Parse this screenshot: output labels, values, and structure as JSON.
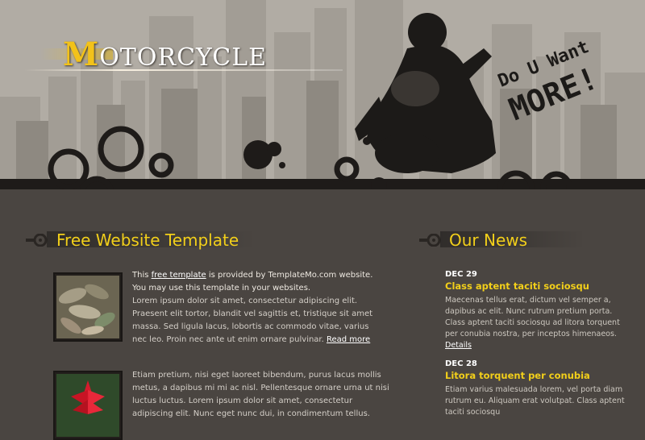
{
  "header": {
    "logo_cap": "M",
    "logo_rest": "OTORCYCLE",
    "slogan_line1": "Do U Want",
    "slogan_line2": "MORE!"
  },
  "main": {
    "heading": "Free Website Template",
    "intro_pre": "This ",
    "intro_link": "free template",
    "intro_post": " is provided by TemplateMo.com website. You may use this template in your websites.",
    "para1": "Lorem ipsum dolor sit amet, consectetur adipiscing elit. Praesent elit tortor, blandit vel sagittis et, tristique sit amet massa. Sed ligula lacus, lobortis ac commodo vitae, varius nec leo. Proin nec ante ut enim ornare pulvinar.",
    "read_more": "Read more",
    "para2": "Etiam pretium, nisi eget laoreet bibendum, purus lacus mollis metus, a dapibus mi mi ac nisl. Pellentesque ornare urna ut nisi luctus luctus. Lorem ipsum dolor sit amet, consectetur adipiscing elit. Nunc eget nunc dui, in condimentum tellus."
  },
  "news": {
    "heading": "Our News",
    "items": [
      {
        "date": "DEC 29",
        "title": "Class aptent taciti sociosqu",
        "body": "Maecenas tellus erat, dictum vel semper a, dapibus ac elit. Nunc rutrum pretium porta. Class aptent taciti sociosqu ad litora torquent per conubia nostra, per inceptos himenaeos.",
        "link": "Details"
      },
      {
        "date": "DEC 28",
        "title": "Litora torquent per conubia",
        "body": "Etiam varius malesuada lorem, vel porta diam rutrum eu. Aliquam erat volutpat. Class aptent taciti sociosqu"
      }
    ]
  },
  "colors": {
    "accent": "#f2cf1a",
    "header_bg": "#b1aca4",
    "page_bg": "#4a4541"
  }
}
